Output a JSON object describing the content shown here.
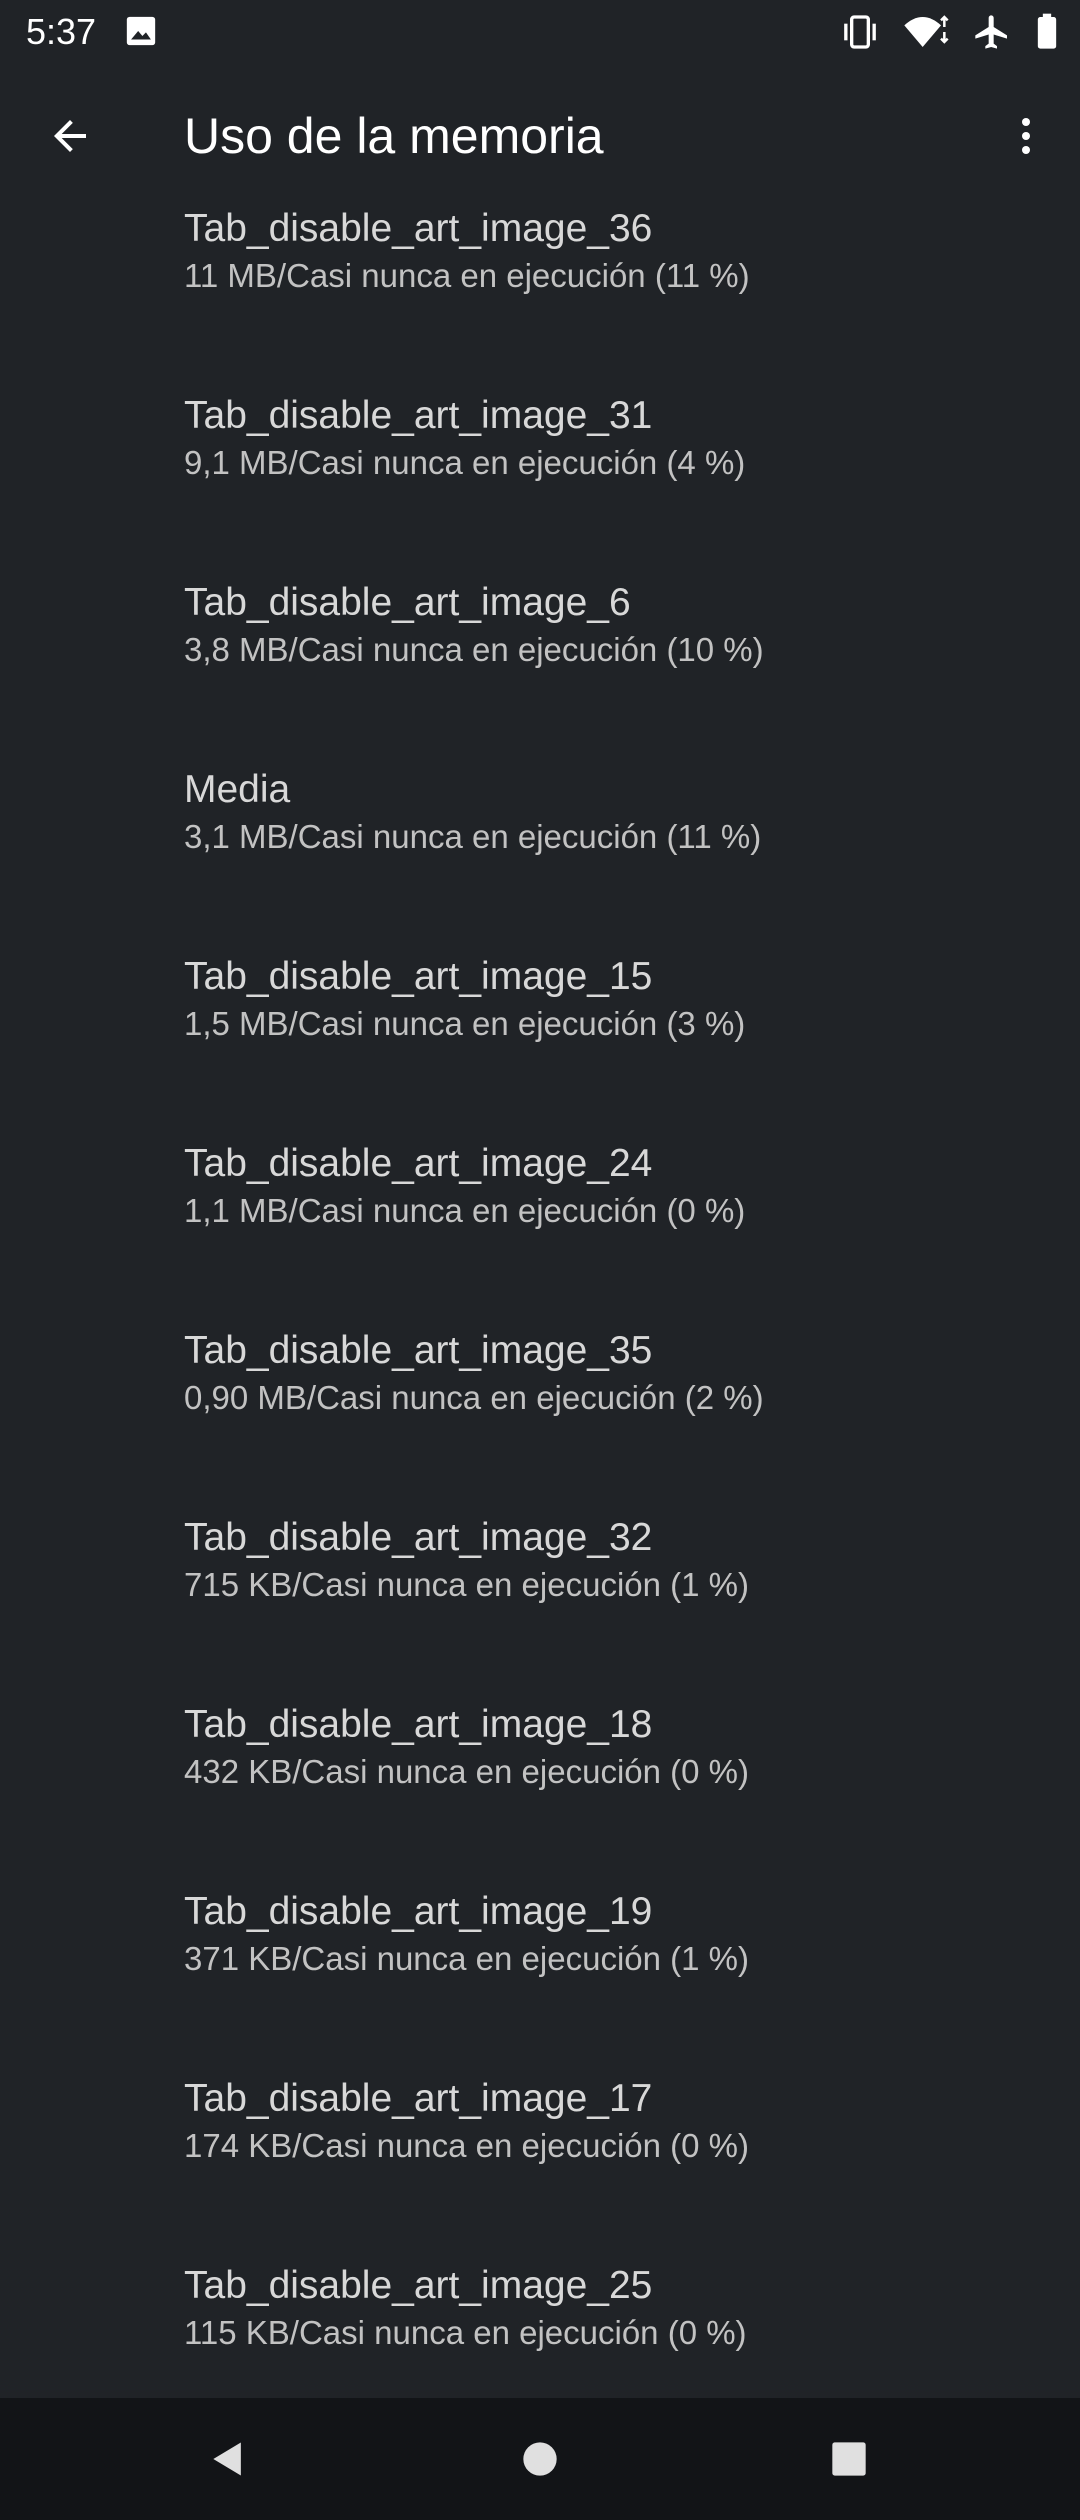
{
  "status_bar": {
    "time": "5:37",
    "icons": [
      "image-icon",
      "vibrate-icon",
      "wifi-icon",
      "airplane-icon",
      "battery-icon"
    ]
  },
  "app_bar": {
    "title": "Uso de la memoria",
    "back_icon": "arrow-back-icon",
    "menu_icon": "more-vert-icon"
  },
  "items": [
    {
      "title": "Tab_disable_art_image_36",
      "summary": "11 MB/Casi nunca en ejecución (11 %)"
    },
    {
      "title": "Tab_disable_art_image_31",
      "summary": "9,1 MB/Casi nunca en ejecución (4 %)"
    },
    {
      "title": "Tab_disable_art_image_6",
      "summary": "3,8 MB/Casi nunca en ejecución (10 %)"
    },
    {
      "title": "Media",
      "summary": "3,1 MB/Casi nunca en ejecución (11 %)"
    },
    {
      "title": "Tab_disable_art_image_15",
      "summary": "1,5 MB/Casi nunca en ejecución (3 %)"
    },
    {
      "title": "Tab_disable_art_image_24",
      "summary": "1,1 MB/Casi nunca en ejecución (0 %)"
    },
    {
      "title": "Tab_disable_art_image_35",
      "summary": "0,90 MB/Casi nunca en ejecución (2 %)"
    },
    {
      "title": "Tab_disable_art_image_32",
      "summary": "715 KB/Casi nunca en ejecución (1 %)"
    },
    {
      "title": "Tab_disable_art_image_18",
      "summary": "432 KB/Casi nunca en ejecución (0 %)"
    },
    {
      "title": "Tab_disable_art_image_19",
      "summary": "371 KB/Casi nunca en ejecución (1 %)"
    },
    {
      "title": "Tab_disable_art_image_17",
      "summary": "174 KB/Casi nunca en ejecución (0 %)"
    },
    {
      "title": "Tab_disable_art_image_25",
      "summary": "115 KB/Casi nunca en ejecución (0 %)"
    }
  ],
  "nav_bar": {
    "back": "nav-back-icon",
    "home": "nav-home-icon",
    "recents": "nav-recents-icon"
  },
  "colors": {
    "background": "#202327",
    "nav_background": "#121417",
    "title_text": "#ffffff",
    "item_title": "#d8d8d8",
    "item_summary": "#c2c2c2"
  }
}
